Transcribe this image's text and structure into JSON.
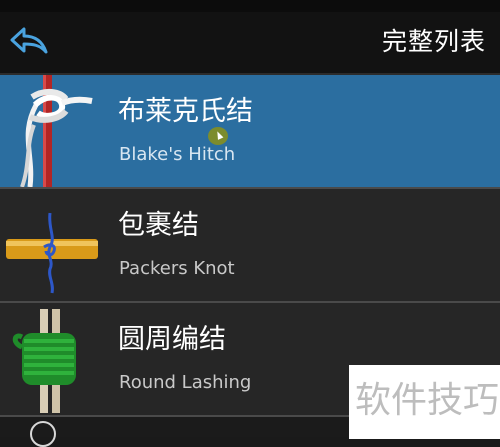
{
  "header": {
    "title": "完整列表",
    "back_icon": "back-arrow-icon",
    "accent_color": "#4aa3df"
  },
  "items": [
    {
      "title": "布莱克氏结",
      "subtitle": "Blake's Hitch",
      "selected": true,
      "icon": "blakes-hitch-knot-image"
    },
    {
      "title": "包裹结",
      "subtitle": "Packers Knot",
      "selected": false,
      "icon": "packers-knot-image"
    },
    {
      "title": "圆周编结",
      "subtitle": "Round Lashing",
      "selected": false,
      "icon": "round-lashing-image"
    }
  ],
  "watermark": {
    "text": "软件技巧"
  }
}
